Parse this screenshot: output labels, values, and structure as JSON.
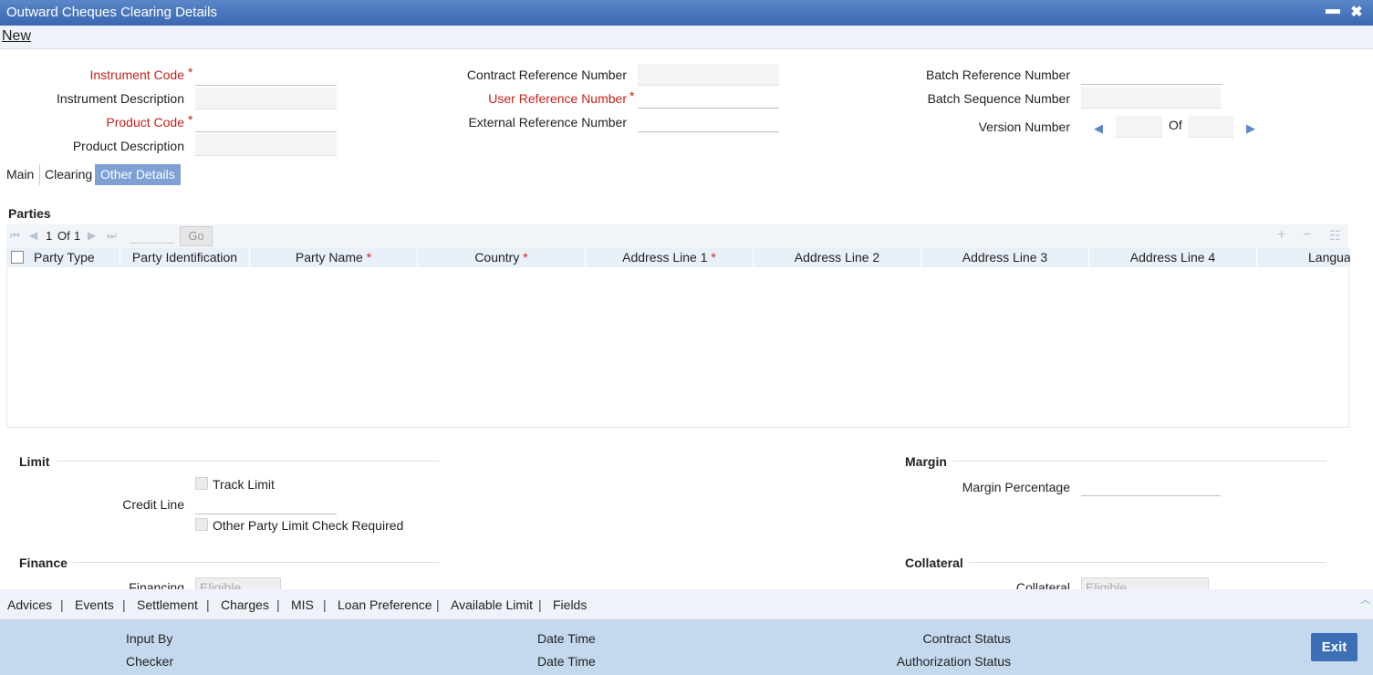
{
  "window": {
    "title": "Outward Cheques Clearing Details",
    "minimize": "▬",
    "close": "✖"
  },
  "menu": {
    "new_label": "New"
  },
  "header": {
    "instrument_code": "Instrument Code",
    "instrument_description": "Instrument Description",
    "product_code": "Product Code",
    "product_description": "Product Description",
    "contract_reference_number": "Contract Reference Number",
    "user_reference_number": "User Reference Number",
    "external_reference_number": "External Reference Number",
    "batch_reference_number": "Batch Reference Number",
    "batch_sequence_number": "Batch Sequence Number",
    "version_number": "Version Number",
    "of_label": "Of",
    "required_mark": "*"
  },
  "tabs": [
    {
      "label": "Main"
    },
    {
      "label": "Clearing"
    },
    {
      "label": "Other Details"
    }
  ],
  "parties": {
    "title": "Parties",
    "pager_current": "1",
    "pager_of": "Of",
    "pager_total": "1",
    "go_label": "Go",
    "columns": [
      "Party Type",
      "Party Identification",
      "Party Name",
      "Country",
      "Address Line 1",
      "Address Line 2",
      "Address Line 3",
      "Address Line 4",
      "Langua"
    ]
  },
  "limit": {
    "title": "Limit",
    "track_limit": "Track Limit",
    "credit_line": "Credit Line",
    "other_party_check": "Other Party Limit Check Required"
  },
  "margin": {
    "title": "Margin",
    "margin_percentage": "Margin Percentage"
  },
  "finance": {
    "title": "Finance",
    "financing_label": "Financing",
    "financing_value": "Eligible"
  },
  "collateral": {
    "title": "Collateral",
    "collateral_label": "Collateral",
    "collateral_value": "Eligible"
  },
  "footer_tabs": [
    "Advices",
    "Events",
    "Settlement",
    "Charges",
    "MIS",
    "Loan Preference",
    "Available Limit",
    "Fields"
  ],
  "status": {
    "input_by": "Input By",
    "checker": "Checker",
    "date_time_1": "Date Time",
    "date_time_2": "Date Time",
    "contract_status": "Contract Status",
    "authorization_status": "Authorization Status",
    "exit_label": "Exit"
  }
}
